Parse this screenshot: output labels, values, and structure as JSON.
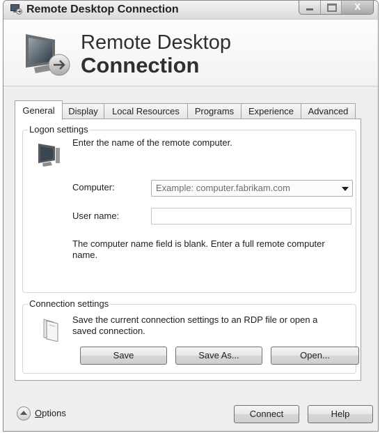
{
  "window": {
    "title": "Remote Desktop Connection",
    "icon": "remote-desktop-icon",
    "controls": {
      "minimize": "minimize-icon",
      "maximize": "maximize-icon",
      "close": "X"
    }
  },
  "header": {
    "line1": "Remote Desktop",
    "line2": "Connection",
    "icon": "remote-desktop-monitor-icon"
  },
  "tabs": [
    {
      "label": "General",
      "active": true
    },
    {
      "label": "Display",
      "active": false
    },
    {
      "label": "Local Resources",
      "active": false
    },
    {
      "label": "Programs",
      "active": false
    },
    {
      "label": "Experience",
      "active": false
    },
    {
      "label": "Advanced",
      "active": false
    }
  ],
  "logon": {
    "legend": "Logon settings",
    "icon": "computer-icon",
    "intro": "Enter the name of the remote computer.",
    "computer_label": "Computer:",
    "computer_placeholder": "Example: computer.fabrikam.com",
    "username_label": "User name:",
    "username_value": "",
    "message_line1": "The computer name field is blank. Enter a full remote computer",
    "message_line2": "name."
  },
  "connection": {
    "legend": "Connection settings",
    "icon": "folder-icon",
    "desc_line1": "Save the current connection settings to an RDP file or open a",
    "desc_line2": "saved connection.",
    "save": "Save",
    "save_as": "Save As...",
    "open": "Open..."
  },
  "footer": {
    "options_mnemonic": "O",
    "options_rest": "ptions",
    "connect": "Connect",
    "help": "Help"
  },
  "colors": {
    "window_bg": "#eeeeee",
    "panel_bg": "#ffffff",
    "border": "#a2a2a2"
  }
}
